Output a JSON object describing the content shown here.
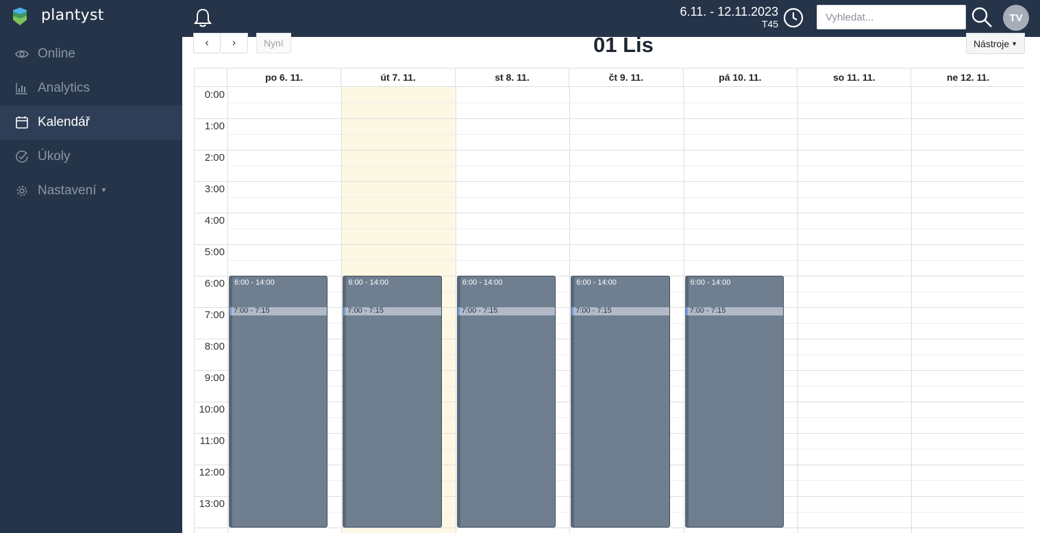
{
  "app": {
    "brand": "plantyst"
  },
  "sidebar": {
    "items": [
      {
        "id": "online",
        "label": "Online",
        "icon": "eye-icon",
        "active": false
      },
      {
        "id": "analytics",
        "label": "Analytics",
        "icon": "bar-chart-icon",
        "active": false
      },
      {
        "id": "kalendar",
        "label": "Kalendář",
        "icon": "calendar-icon",
        "active": true
      },
      {
        "id": "ukoly",
        "label": "Úkoly",
        "icon": "check-circle-icon",
        "active": false
      },
      {
        "id": "nastaveni",
        "label": "Nastavení",
        "icon": "gear-icon",
        "active": false,
        "has_dropdown": true
      }
    ]
  },
  "header": {
    "week_range": "6.11. - 12.11.2023",
    "week_code": "T45",
    "search": {
      "placeholder": "Vyhledat...",
      "value": ""
    },
    "avatar_initials": "TV"
  },
  "toolbar": {
    "prev_label": "‹",
    "next_label": "›",
    "now_label": "Nyní",
    "title": "01 Lis",
    "tools_label": "Nástroje"
  },
  "calendar": {
    "days": [
      "po 6. 11.",
      "út 7. 11.",
      "st 8. 11.",
      "čt 9. 11.",
      "pá 10. 11.",
      "so 11. 11.",
      "ne 12. 11."
    ],
    "today_index": 1,
    "hours": [
      "0:00",
      "1:00",
      "2:00",
      "3:00",
      "4:00",
      "5:00",
      "6:00",
      "7:00",
      "8:00",
      "9:00",
      "10:00",
      "11:00",
      "12:00",
      "13:00"
    ],
    "events": [
      {
        "day": 0,
        "label": "6:00 - 14:00",
        "sub_label": "7:00 - 7:15"
      },
      {
        "day": 1,
        "label": "6:00 - 14:00",
        "sub_label": "7:00 - 7:15"
      },
      {
        "day": 2,
        "label": "6:00 - 14:00",
        "sub_label": "7:00 - 7:15"
      },
      {
        "day": 3,
        "label": "6:00 - 14:00",
        "sub_label": "7:00 - 7:15"
      },
      {
        "day": 4,
        "label": "6:00 - 14:00",
        "sub_label": "7:00 - 7:15"
      }
    ]
  },
  "colors": {
    "sidebar_bg": "#26344a",
    "active_item_bg": "#2e3e56",
    "event_bg": "#707f90",
    "today_bg": "#fdf8e3"
  }
}
